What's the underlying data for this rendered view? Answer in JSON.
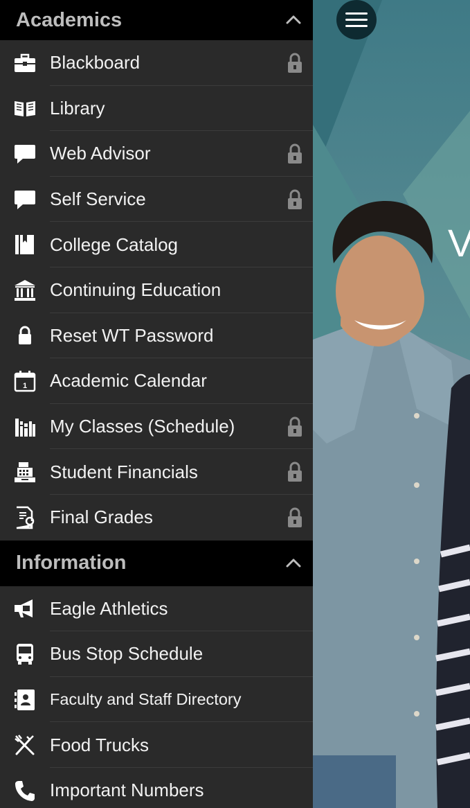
{
  "sections": [
    {
      "title": "Academics",
      "items": [
        {
          "label": "Blackboard",
          "icon": "briefcase-icon",
          "locked": true
        },
        {
          "label": "Library",
          "icon": "book-icon",
          "locked": false
        },
        {
          "label": "Web Advisor",
          "icon": "chat-bubble-icon",
          "locked": true
        },
        {
          "label": "Self Service",
          "icon": "chat-bubble-icon",
          "locked": true
        },
        {
          "label": "College Catalog",
          "icon": "catalog-icon",
          "locked": false
        },
        {
          "label": "Continuing Education",
          "icon": "institution-icon",
          "locked": false
        },
        {
          "label": "Reset WT Password",
          "icon": "padlock-icon",
          "locked": false
        },
        {
          "label": "Academic Calendar",
          "icon": "calendar-icon",
          "locked": false
        },
        {
          "label": "My Classes (Schedule)",
          "icon": "books-shelf-icon",
          "locked": true
        },
        {
          "label": "Student Financials",
          "icon": "cash-register-icon",
          "locked": true
        },
        {
          "label": "Final Grades",
          "icon": "certificate-icon",
          "locked": true
        }
      ]
    },
    {
      "title": "Information",
      "items": [
        {
          "label": "Eagle Athletics",
          "icon": "megaphone-icon",
          "locked": false
        },
        {
          "label": "Bus Stop Schedule",
          "icon": "bus-icon",
          "locked": false
        },
        {
          "label": "Faculty and Staff Directory",
          "icon": "contact-book-icon",
          "locked": false
        },
        {
          "label": "Food Trucks",
          "icon": "utensils-icon",
          "locked": false
        },
        {
          "label": "Important Numbers",
          "icon": "phone-icon",
          "locked": false
        }
      ]
    }
  ],
  "colors": {
    "header_bg": "#000000",
    "item_bg": "#2a2a2a",
    "header_text": "#bdbdbd",
    "item_text": "#f2f2f2",
    "lock": "#8a8a8a"
  }
}
